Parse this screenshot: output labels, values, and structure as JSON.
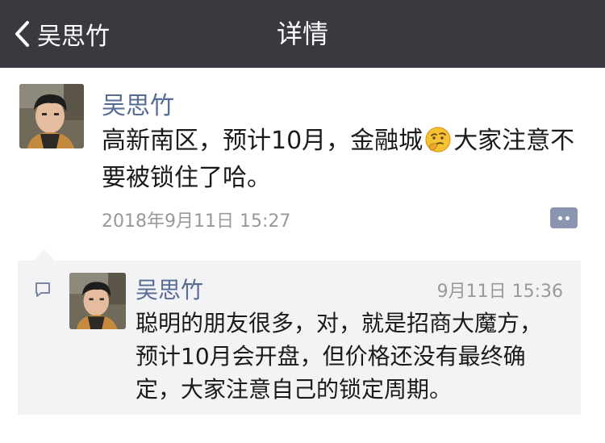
{
  "navbar": {
    "back_label": "吴思竹",
    "title": "详情"
  },
  "post": {
    "author": "吴思竹",
    "text_before_emoji": "高新南区，预计10月，金融城",
    "emoji": "thinking-face-emoji",
    "text_after_emoji": "大家注意不要被锁住了哈。",
    "timestamp": "2018年9月11日 15:27"
  },
  "comment": {
    "author": "吴思竹",
    "time": "9月11日 15:36",
    "text": "聪明的朋友很多，对，就是招商大魔方，预计10月会开盘，但价格还没有最终确定，大家注意自己的锁定周期。"
  },
  "colors": {
    "navbar_bg": "#393a3f",
    "name_blue": "#576b95",
    "timestamp_gray": "#999999",
    "comment_bg": "#f3f3f5"
  }
}
